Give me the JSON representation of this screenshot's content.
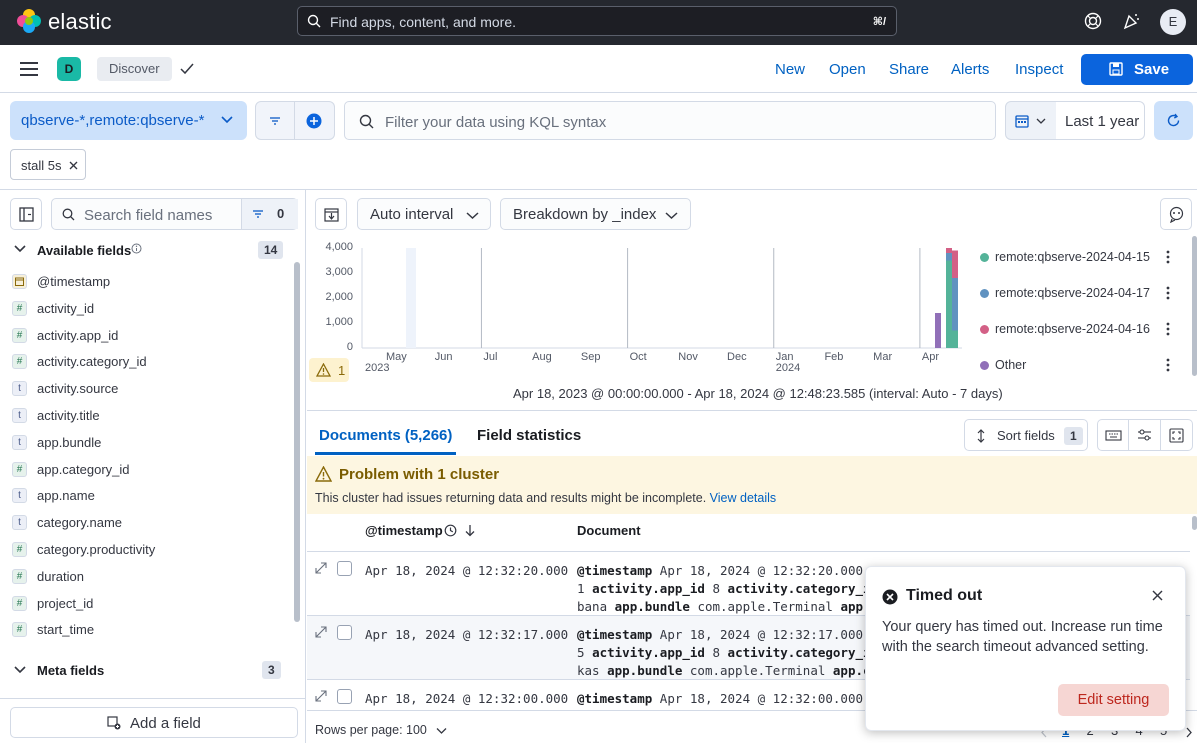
{
  "header": {
    "logo_text": "elastic",
    "search_placeholder": "Find apps, content, and more.",
    "search_shortcut": "⌘/",
    "user_initial": "E"
  },
  "appbar": {
    "space_initial": "D",
    "breadcrumb": "Discover",
    "links": [
      "New",
      "Open",
      "Share",
      "Alerts",
      "Inspect"
    ],
    "save_label": "Save"
  },
  "query": {
    "data_view": "qbserve-*,remote:qbserve-*",
    "kql_placeholder": "Filter your data using KQL syntax",
    "date_range": "Last 1 year",
    "filter_pill": "stall 5s"
  },
  "sidebar": {
    "search_placeholder": "Search field names",
    "filter_count": "0",
    "available_label": "Available fields",
    "available_count": "14",
    "fields": [
      {
        "type": "date",
        "name": "@timestamp"
      },
      {
        "type": "#",
        "name": "activity_id"
      },
      {
        "type": "#",
        "name": "activity.app_id"
      },
      {
        "type": "#",
        "name": "activity.category_id"
      },
      {
        "type": "t",
        "name": "activity.source"
      },
      {
        "type": "t",
        "name": "activity.title"
      },
      {
        "type": "t",
        "name": "app.bundle"
      },
      {
        "type": "#",
        "name": "app.category_id"
      },
      {
        "type": "t",
        "name": "app.name"
      },
      {
        "type": "t",
        "name": "category.name"
      },
      {
        "type": "#",
        "name": "category.productivity"
      },
      {
        "type": "#",
        "name": "duration"
      },
      {
        "type": "#",
        "name": "project_id"
      },
      {
        "type": "#",
        "name": "start_time"
      }
    ],
    "meta_label": "Meta fields",
    "meta_count": "3",
    "add_field_label": "Add a field"
  },
  "chart_toolbar": {
    "interval_label": "Auto interval",
    "breakdown_label": "Breakdown by _index"
  },
  "chart_data": {
    "type": "bar",
    "x_ticks": [
      "May",
      "Jun",
      "Jul",
      "Aug",
      "Sep",
      "Oct",
      "Nov",
      "Dec",
      "Jan",
      "Feb",
      "Mar",
      "Apr"
    ],
    "x_year_labels": [
      {
        "label": "2023",
        "under": "May"
      },
      {
        "label": "2024",
        "under": "Jan"
      }
    ],
    "y_ticks": [
      "0",
      "1,000",
      "2,000",
      "3,000",
      "4,000"
    ],
    "ylim": [
      0,
      4000
    ],
    "series": [
      {
        "name": "remote:qbserve-2024-04-15",
        "color": "#54b399"
      },
      {
        "name": "remote:qbserve-2024-04-17",
        "color": "#6092c0"
      },
      {
        "name": "remote:qbserve-2024-04-16",
        "color": "#d36086"
      },
      {
        "name": "Other",
        "color": "#9170b8"
      }
    ],
    "footer": "Apr 18, 2023 @ 00:00:00.000 - Apr 18, 2024 @ 12:48:23.585 (interval: Auto - 7 days)",
    "warning_count": "1"
  },
  "tabs": {
    "documents": "Documents (5,266)",
    "field_stats": "Field statistics",
    "sort_label": "Sort fields",
    "sort_count": "1"
  },
  "callout": {
    "title": "Problem with 1 cluster",
    "text": "This cluster had issues returning data and results might be incomplete.",
    "link": "View details"
  },
  "table": {
    "col_timestamp": "@timestamp",
    "col_document": "Document",
    "rows": [
      {
        "ts": "Apr 18, 2024 @ 12:32:20.000",
        "l1": "Apr 18, 2024 @ 12:32:20.000 a",
        "l2a": "1",
        "l2b": "8",
        "l3a": "bana",
        "l3b": "com.apple.Terminal"
      },
      {
        "ts": "Apr 18, 2024 @ 12:32:17.000",
        "l1": "Apr 18, 2024 @ 12:32:17.000 a",
        "l2a": "5",
        "l2b": "8",
        "l3a": "kas",
        "l3b": "com.apple.Terminal"
      },
      {
        "ts": "Apr 18, 2024 @ 12:32:00.000",
        "l1": "Apr 18, 2024 @ 12:32:00.000 a"
      }
    ],
    "rows_per_page": "Rows per page: 100",
    "pages": [
      "1",
      "2",
      "3",
      "4",
      "5"
    ]
  },
  "toast": {
    "title": "Timed out",
    "body": "Your query has timed out. Increase run time with the search timeout advanced setting.",
    "button": "Edit setting"
  }
}
